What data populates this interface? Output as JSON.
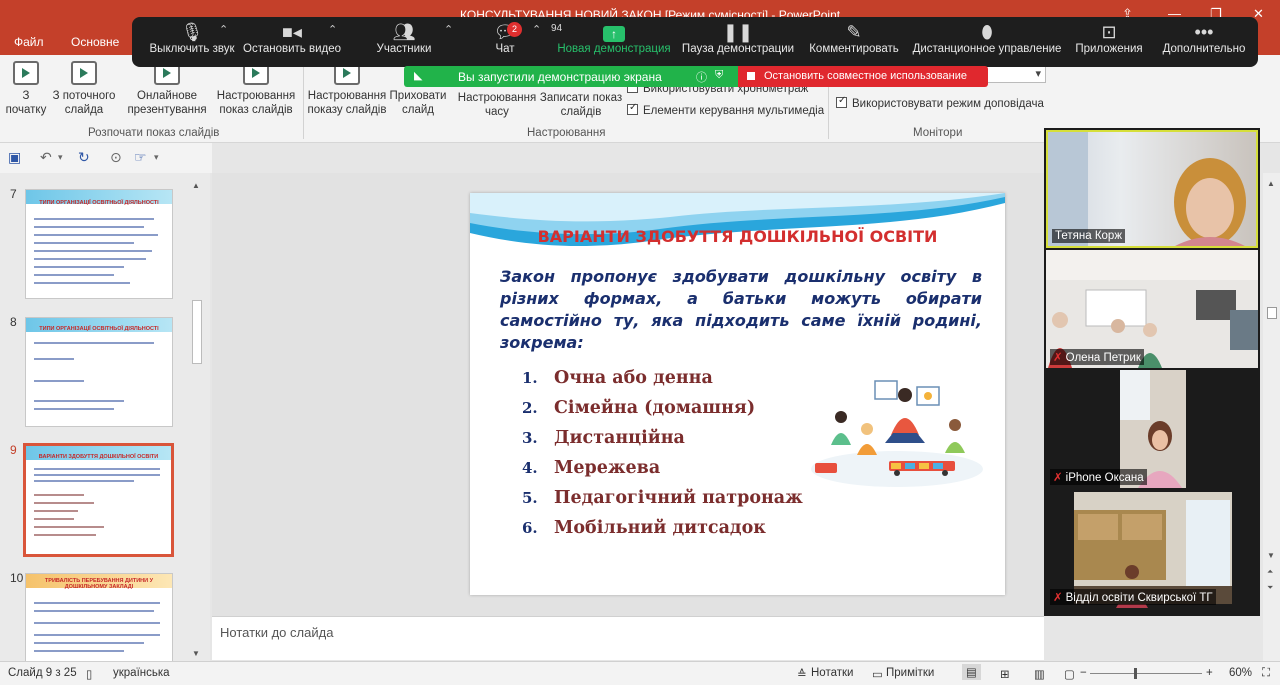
{
  "window": {
    "title": "КОНСУЛЬТУВАННЯ НОВИЙ ЗАКОН [Режим сумісності] - PowerPoint"
  },
  "ribbon_tabs": [
    "Файл",
    "Основне"
  ],
  "ribbon": {
    "buttons": [
      {
        "label": "З початку"
      },
      {
        "label": "З поточного слайда"
      },
      {
        "label": "Онлайнове презентування"
      },
      {
        "label": "Настроювання показ слайдів"
      },
      {
        "label": "Настроювання показу слайдів"
      },
      {
        "label": "Приховати слайд"
      },
      {
        "label": "Настроювання часу"
      },
      {
        "label": "Записати показ слайдів"
      }
    ],
    "checkboxes": [
      {
        "label": "Використовувати хронометраж"
      },
      {
        "label": "Елементи керування мультимедіа"
      },
      {
        "label": "Використовувати режим доповідача"
      }
    ],
    "groups": [
      "Розпочати показ слайдів",
      "Настроювання",
      "Монітори"
    ]
  },
  "zoom_toolbar": {
    "items": [
      {
        "label": "Выключить звук",
        "icon": "microphone-icon"
      },
      {
        "label": "Остановить видео",
        "icon": "video-camera-icon"
      },
      {
        "label": "Участники",
        "icon": "participants-icon"
      },
      {
        "label": "Чат",
        "icon": "chat-icon"
      },
      {
        "label": "Новая демонстрация",
        "icon": "share-screen-icon"
      },
      {
        "label": "Пауза демонстрации",
        "icon": "pause-icon"
      },
      {
        "label": "Комментировать",
        "icon": "pencil-icon"
      },
      {
        "label": "Дистанционное управление",
        "icon": "mouse-icon"
      },
      {
        "label": "Приложения",
        "icon": "apps-icon"
      },
      {
        "label": "Дополнительно",
        "icon": "more-icon"
      }
    ],
    "participants_count": "94",
    "chat_badge": "2",
    "sharing_notice": "Вы запустили демонстрацию экрана",
    "stop_sharing_label": "Остановить совместное использование"
  },
  "slides_panel": {
    "thumbnails": [
      {
        "number": "7",
        "title": "ТИПИ ОРГАНІЗАЦІЇ ОСВІТНЬОЇ ДІЯЛЬНОСТІ"
      },
      {
        "number": "8",
        "title": "ТИПИ ОРГАНІЗАЦІЇ ОСВІТНЬОЇ ДІЯЛЬНОСТІ"
      },
      {
        "number": "9",
        "title": "ВАРІАНТИ ЗДОБУТТЯ ДОШКІЛЬНОЇ ОСВІТИ"
      },
      {
        "number": "10",
        "title": "ТРИВАЛІСТЬ ПЕРЕБУВАННЯ ДИТИНИ У ДОШКІЛЬНОМУ ЗАКЛАДІ"
      }
    ],
    "active_number": "9"
  },
  "slide": {
    "title": "ВАРІАНТИ ЗДОБУТТЯ ДОШКІЛЬНОЇ ОСВІТИ",
    "body": "Закон пропонує здобувати дошкільну освіту в різних формах, а батьки можуть обирати самостійно ту, яка підходить саме їхній родині, зокрема:",
    "list": [
      {
        "n": "1.",
        "text": "Очна або денна"
      },
      {
        "n": "2.",
        "text": "Сімейна (домашня)"
      },
      {
        "n": "3.",
        "text": "Дистанційна"
      },
      {
        "n": "4.",
        "text": "Мережева"
      },
      {
        "n": "5.",
        "text": "Педагогічний патронаж"
      },
      {
        "n": "6.",
        "text": "Мобільний дитсадок"
      }
    ]
  },
  "notes_placeholder": "Нотатки до слайда",
  "video_participants": [
    {
      "name": "Тетяна Корж",
      "muted": false
    },
    {
      "name": "Олена Петрик",
      "muted": true
    },
    {
      "name": "iPhone Оксана",
      "muted": true
    },
    {
      "name": "Відділ освіти Сквирської ТГ",
      "muted": true
    }
  ],
  "status_bar": {
    "slide_counter": "Слайд 9 з 25",
    "language": "українська",
    "notes_label": "Нотатки",
    "comments_label": "Примітки",
    "zoom": "60%"
  },
  "colors": {
    "accent": "#c4402a",
    "zoom_green": "#21b34a",
    "zoom_red": "#e0282e",
    "slide_title": "#d32f2f",
    "slide_body": "#1a2f6e"
  }
}
